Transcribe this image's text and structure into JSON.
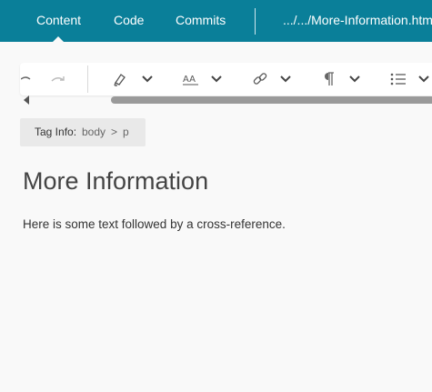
{
  "nav": {
    "tabs": [
      {
        "label": "Content",
        "active": true
      },
      {
        "label": "Code"
      },
      {
        "label": "Commits"
      }
    ],
    "path": ".../.../More-Information.htm"
  },
  "toolbar": {
    "icons": [
      "undo-icon",
      "redo-icon",
      "highlighter-icon",
      "chevron-down-icon",
      "font-size-icon",
      "chevron-down-icon",
      "link-icon",
      "chevron-down-icon",
      "paragraph-icon",
      "chevron-down-icon",
      "bulleted-list-icon",
      "chevron-down-icon"
    ]
  },
  "tag_info": {
    "label": "Tag Info:",
    "path": [
      "body",
      "p"
    ],
    "separator": ">"
  },
  "document": {
    "heading": "More Information",
    "paragraph": "Here is some text followed by a cross-reference."
  },
  "colors": {
    "nav_bg": "#0a7f99",
    "page_bg": "#f9f9f9",
    "tag_info_bg": "#e9e9e9"
  }
}
